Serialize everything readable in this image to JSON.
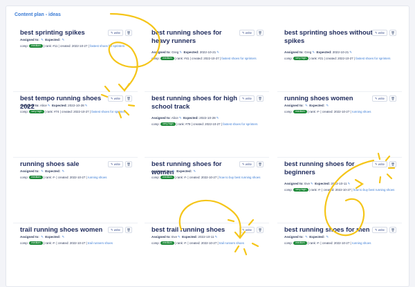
{
  "panel_title": "Content plan - ideas",
  "labels": {
    "write": "write",
    "assigned": "Assigned to:",
    "expected": "Expected:",
    "comp": "comp:",
    "created": "created:",
    "rank": "rank:"
  },
  "cards": [
    {
      "title": "best sprinting spikes",
      "assignee": "",
      "expected": "",
      "comp": "medium",
      "rank": "#11",
      "created": "2022-10-27",
      "link": "fastest shoes for sprinters"
    },
    {
      "title": "best running shoes for heavy runners",
      "assignee": "Greg",
      "expected": "2022-10-21",
      "comp": "medium",
      "rank": "#41",
      "created": "2022-10-27",
      "link": "fastest shoes for sprinters"
    },
    {
      "title": "best sprinting shoes without spikes",
      "assignee": "Greg",
      "expected": "2022-10-21",
      "comp": "very high",
      "rank": "#21",
      "created": "2022-10-27",
      "link": "fastest shoes for sprinters"
    },
    {
      "title": "best tempo running shoes 2022",
      "assignee": "Alice",
      "expected": "2022-10-28",
      "comp": "very high",
      "rank": "#74",
      "created": "2022-10-27",
      "link": "fastest shoes for sprinters"
    },
    {
      "title": "best running shoes for high school track",
      "assignee": "Alice",
      "expected": "2022-10-28",
      "comp": "very high",
      "rank": "#78",
      "created": "2022-10-27",
      "link": "fastest shoes for sprinters"
    },
    {
      "title": "running shoes women",
      "assignee": "",
      "expected": "",
      "comp": "medium",
      "rank": "#-",
      "created": "2022-10-27",
      "link": "running shoes"
    },
    {
      "title": "running shoes sale",
      "assignee": "",
      "expected": "",
      "comp": "medium",
      "rank": "#-",
      "created": "2022-10-27",
      "link": "running shoes"
    },
    {
      "title": "best running shoes for women",
      "assignee": "",
      "expected": "",
      "comp": "medium",
      "rank": "#-",
      "created": "2022-10-27",
      "link": "how to buy best running shoes"
    },
    {
      "title": "best running shoes for beginners",
      "assignee": "Eve",
      "expected": "2022-10-11",
      "comp": "very high",
      "rank": "#-",
      "created": "2022-10-27",
      "link": "how to buy best running shoes"
    },
    {
      "title": "trail running shoes women",
      "assignee": "",
      "expected": "",
      "comp": "medium",
      "rank": "#-",
      "created": "2022-10-27",
      "link": "trail runners shoes"
    },
    {
      "title": "best trail running shoes",
      "assignee": "Eve",
      "expected": "2022-10-11",
      "comp": "medium",
      "rank": "#-",
      "created": "2022-10-27",
      "link": "trail runners shoes"
    },
    {
      "title": "best running shoes for men",
      "assignee": "",
      "expected": "",
      "comp": "medium",
      "rank": "#-",
      "created": "2022-10-27",
      "link": "running shoes"
    }
  ],
  "colors": {
    "accent": "#3a7bd5",
    "title": "#1f2b5c",
    "pill": "#1f8a3a",
    "annotation": "#f5c518"
  },
  "icons": {
    "write": "pencil-icon",
    "delete": "trash-icon"
  }
}
